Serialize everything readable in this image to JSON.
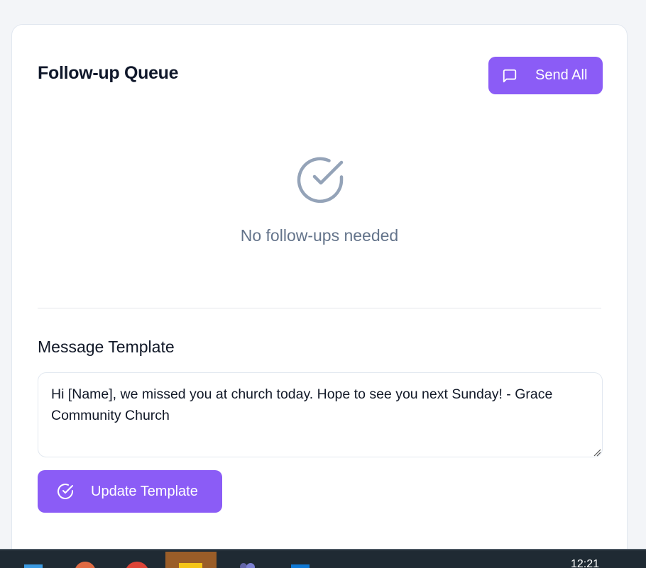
{
  "queue": {
    "title": "Follow-up Queue",
    "send_all_label": "Send All",
    "empty_message": "No follow-ups needed"
  },
  "template": {
    "label": "Message Template",
    "value": "Hi [Name], we missed you at church today. Hope to see you next Sunday! - Grace Community Church",
    "update_label": "Update Template"
  },
  "taskbar": {
    "time": "12:21",
    "apps": [
      "start-icon",
      "powerpoint-icon",
      "chrome-icon",
      "file-explorer-icon",
      "teams-icon",
      "outlook-icon"
    ]
  },
  "colors": {
    "accent": "#8b5cf6",
    "empty_icon": "#94a3b8",
    "muted_text": "#64748b"
  }
}
